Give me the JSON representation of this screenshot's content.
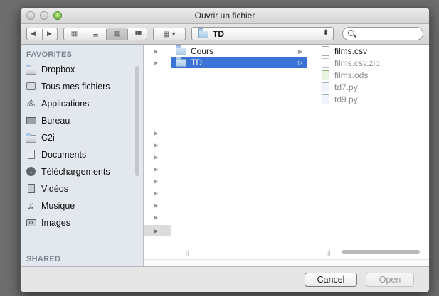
{
  "window": {
    "title": "Ouvrir un fichier"
  },
  "toolbar": {
    "path_folder": "TD",
    "path_arrows": "⬍",
    "search_placeholder": "",
    "view_icons": "▦",
    "view_list": "≡",
    "view_columns": "▥",
    "view_coverflow": "▮▮▮",
    "arrange": "▦ ▾",
    "back": "◀",
    "forward": "▶"
  },
  "sidebar": {
    "favorites_header": "FAVORITES",
    "shared_header": "SHARED",
    "items": [
      {
        "label": "Dropbox",
        "icon": "folder-icon"
      },
      {
        "label": "Tous mes fichiers",
        "icon": "all-files-icon"
      },
      {
        "label": "Applications",
        "icon": "applications-icon"
      },
      {
        "label": "Bureau",
        "icon": "desktop-icon"
      },
      {
        "label": "C2i",
        "icon": "folder-icon"
      },
      {
        "label": "Documents",
        "icon": "documents-icon"
      },
      {
        "label": "Téléchargements",
        "icon": "downloads-icon"
      },
      {
        "label": "Vidéos",
        "icon": "movies-icon"
      },
      {
        "label": "Musique",
        "icon": "music-icon"
      },
      {
        "label": "Images",
        "icon": "pictures-icon"
      }
    ]
  },
  "browser": {
    "column2": [
      {
        "label": "Cours",
        "selected": false
      },
      {
        "label": "TD",
        "selected": true
      }
    ],
    "column3": [
      {
        "label": "films.csv",
        "enabled": true
      },
      {
        "label": "films.csv.zip",
        "enabled": false
      },
      {
        "label": "films.ods",
        "enabled": false
      },
      {
        "label": "td7.py",
        "enabled": false
      },
      {
        "label": "td9.py",
        "enabled": false
      }
    ]
  },
  "buttons": {
    "cancel": "Cancel",
    "open": "Open"
  },
  "colors": {
    "selection": "#3b73d6",
    "sidebar_bg": "#e3e8ee"
  }
}
